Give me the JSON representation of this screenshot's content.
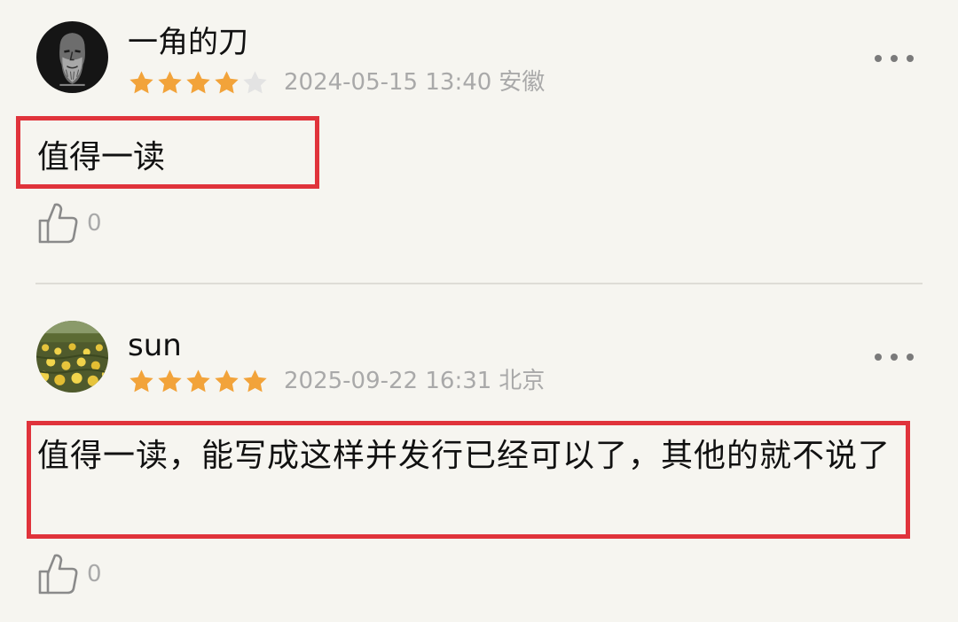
{
  "reviews": [
    {
      "username": "一角的刀",
      "rating": 4,
      "max_rating": 5,
      "date": "2024-05-15 13:40",
      "location": "安徽",
      "content": "值得一读",
      "likes": "0",
      "avatar_icon": "bearded-man-sketch-icon"
    },
    {
      "username": "sun",
      "rating": 5,
      "max_rating": 5,
      "date": "2025-09-22 16:31",
      "location": "北京",
      "content": "值得一读，能写成这样并发行已经可以了，其他的就不说了",
      "likes": "0",
      "avatar_icon": "flower-field-photo-icon"
    }
  ],
  "colors": {
    "background": "#f6f5f0",
    "star_filled": "#f2a33a",
    "star_empty": "#e3e3e3",
    "highlight_border": "#e0333b",
    "meta_text": "#a9a9a9"
  }
}
